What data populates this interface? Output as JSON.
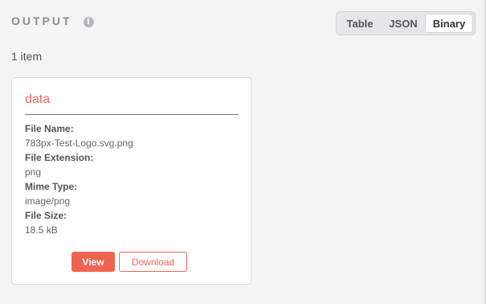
{
  "header": {
    "title": "OUTPUT",
    "info_icon": "i"
  },
  "view_toggle": {
    "options": [
      "Table",
      "JSON",
      "Binary"
    ],
    "selected": "Binary"
  },
  "item_count": "1 item",
  "card": {
    "title": "data",
    "fields": [
      {
        "label": "File Name:",
        "value": "783px-Test-Logo.svg.png"
      },
      {
        "label": "File Extension:",
        "value": "png"
      },
      {
        "label": "Mime Type:",
        "value": "image/png"
      },
      {
        "label": "File Size:",
        "value": "18.5 kB"
      }
    ],
    "view_label": "View",
    "download_label": "Download"
  },
  "colors": {
    "accent": "#ee6451",
    "background": "#f4f4f5"
  }
}
